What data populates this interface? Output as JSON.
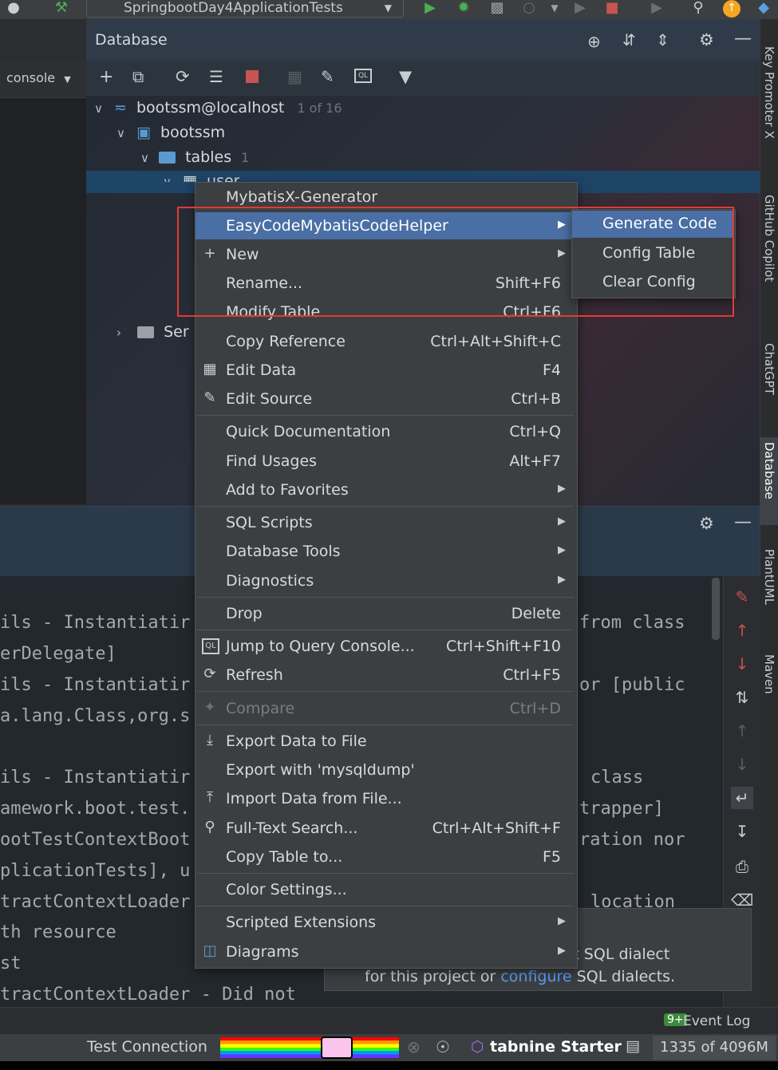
{
  "toolbar": {
    "run_config": "SpringbootDay4ApplicationTests"
  },
  "left_panel": {
    "console_label": "console"
  },
  "database": {
    "title": "Database",
    "tree": {
      "datasource": "bootssm@localhost",
      "datasource_count": "1 of 16",
      "schema": "bootssm",
      "tables_label": "tables",
      "tables_count": "1",
      "table": "user",
      "server_objects": "Ser"
    }
  },
  "context_menu": {
    "items": [
      {
        "label": "MybatisX-Generator",
        "shortcut": ""
      },
      {
        "label": "EasyCodeMybatisCodeHelper",
        "shortcut": "",
        "submenu": true
      },
      {
        "label": "New",
        "shortcut": "",
        "submenu": true
      },
      {
        "label": "Rename...",
        "shortcut": "Shift+F6"
      },
      {
        "label": "Modify Table",
        "shortcut": "Ctrl+F6"
      },
      {
        "label": "Copy Reference",
        "shortcut": "Ctrl+Alt+Shift+C"
      },
      {
        "label": "Edit Data",
        "shortcut": "F4"
      },
      {
        "label": "Edit Source",
        "shortcut": "Ctrl+B"
      },
      {
        "label": "Quick Documentation",
        "shortcut": "Ctrl+Q"
      },
      {
        "label": "Find Usages",
        "shortcut": "Alt+F7"
      },
      {
        "label": "Add to Favorites",
        "shortcut": "",
        "submenu": true
      },
      {
        "label": "SQL Scripts",
        "shortcut": "",
        "submenu": true
      },
      {
        "label": "Database Tools",
        "shortcut": "",
        "submenu": true
      },
      {
        "label": "Diagnostics",
        "shortcut": "",
        "submenu": true
      },
      {
        "label": "Drop",
        "shortcut": "Delete"
      },
      {
        "label": "Jump to Query Console...",
        "shortcut": "Ctrl+Shift+F10"
      },
      {
        "label": "Refresh",
        "shortcut": "Ctrl+F5"
      },
      {
        "label": "Compare",
        "shortcut": "Ctrl+D"
      },
      {
        "label": "Export Data to File",
        "shortcut": ""
      },
      {
        "label": "Export with 'mysqldump'",
        "shortcut": ""
      },
      {
        "label": "Import Data from File...",
        "shortcut": ""
      },
      {
        "label": "Full-Text Search...",
        "shortcut": "Ctrl+Alt+Shift+F"
      },
      {
        "label": "Copy Table to...",
        "shortcut": "F5"
      },
      {
        "label": "Color Settings...",
        "shortcut": ""
      },
      {
        "label": "Scripted Extensions",
        "shortcut": "",
        "submenu": true
      },
      {
        "label": "Diagrams",
        "shortcut": "",
        "submenu": true
      }
    ]
  },
  "submenu": {
    "items": [
      "Generate Code",
      "Config Table",
      "Clear Config"
    ]
  },
  "right_tabs": [
    "Key Promoter X",
    "GitHub Copilot",
    "ChatGPT",
    "Database",
    "PlantUML",
    "Maven"
  ],
  "run_log": [
    "ils - Instantiatir",
    "erDelegate]",
    "ils - Instantiatir",
    "a.lang.Class,org.s",
    "",
    "ils - Instantiatir",
    "amework.boot.test.",
    "ootTestContextBoot",
    "plicationTests], u",
    "tractContextLoader",
    "th resource",
    "st",
    "tractContextLoader - Did not"
  ],
  "run_log_right": [
    "from class",
    "",
    "or [public",
    "",
    "",
    "class",
    "trapper]",
    "ration nor",
    "",
    "location"
  ],
  "notification": {
    "line1_tail": "ult SQL dialect",
    "line2_pre": "for this project or",
    "line2_link": "configure",
    "line2_post": "SQL dialects."
  },
  "status": {
    "event_log": "Event Log",
    "event_count": "9+",
    "test_connection": "Test Connection",
    "tabnine": "tabnine",
    "tabnine_plan": "Starter",
    "memory": "1335 of 4096M"
  }
}
